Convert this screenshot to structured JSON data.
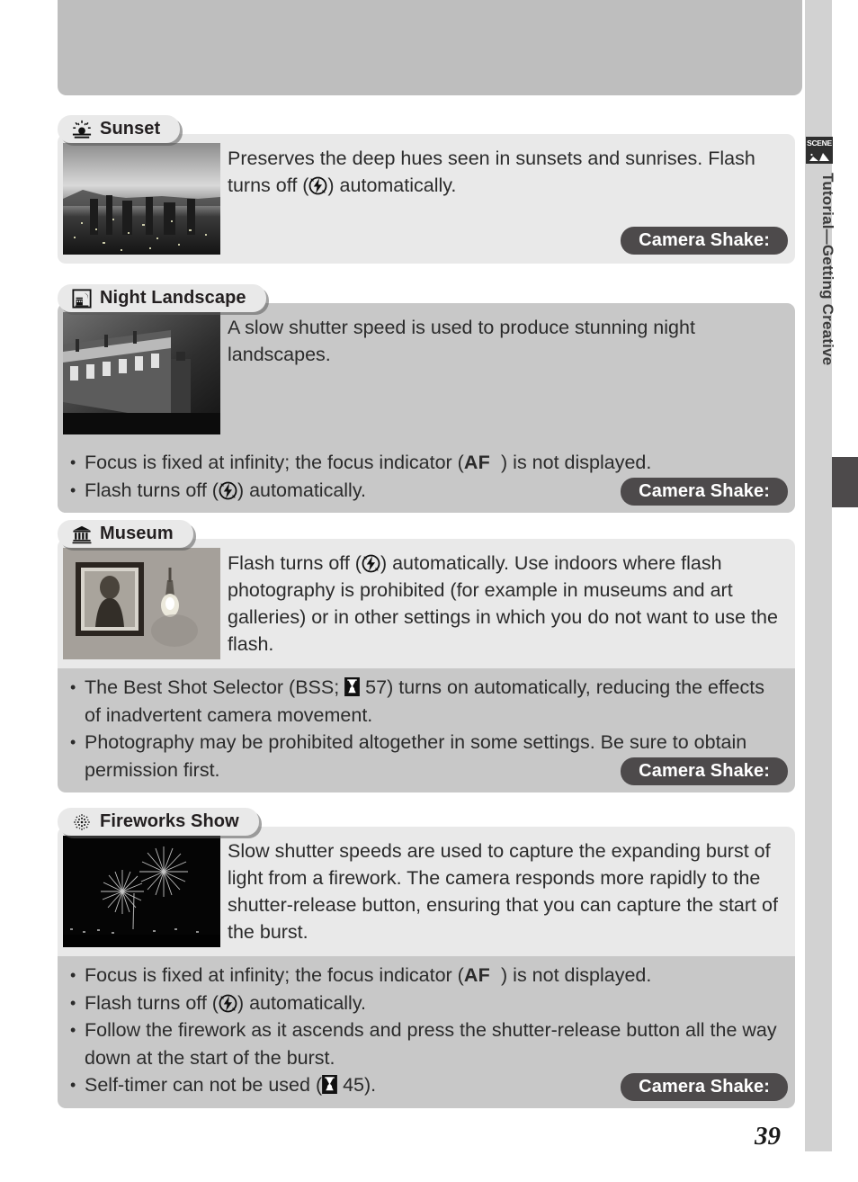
{
  "page": {
    "number": "39",
    "side_tab_label": "Tutorial—Getting Creative",
    "side_tab_icon": "scene-mode-icon",
    "scene_icon_word": "SCENE"
  },
  "colors": {
    "page_bg": "#ffffff",
    "top_block": "#bebebe",
    "panel_light": "#e9e9e9",
    "panel_mid": "#c8c8c8",
    "badge_dark": "#4d4a4b",
    "side_bar": "#d2d2d2",
    "text": "#2b2b2b",
    "heading": "#231f20"
  },
  "shake_badge_label": "Camera Shake:",
  "sections": [
    {
      "id": "sunset",
      "icon": "sunset-icon",
      "title": "Sunset",
      "thumb_alt": "city-skyline-at-sunset-photo",
      "description_parts": [
        {
          "t": "text",
          "v": "Preserves the deep hues seen in sunsets and sunrises.  Flash turns off ("
        },
        {
          "t": "icon",
          "v": "flash-off-icon"
        },
        {
          "t": "text",
          "v": ") automatically."
        }
      ],
      "description_plain": "Preserves the deep hues seen in sunsets and sunrises.  Flash turns off (flash-off-icon) automatically.",
      "bullets": []
    },
    {
      "id": "night-landscape",
      "icon": "night-landscape-icon",
      "title": "Night Landscape",
      "thumb_alt": "illuminated-building-at-night-photo",
      "description_parts": [
        {
          "t": "text",
          "v": "A slow shutter speed is used to produce stunning night landscapes."
        }
      ],
      "description_plain": "A slow shutter speed is used to produce stunning night landscapes.",
      "bullets": [
        [
          {
            "t": "text",
            "v": "Focus is fixed at infinity; the focus indicator ("
          },
          {
            "t": "af",
            "v": "AF"
          },
          {
            "t": "text",
            "v": "  ) is not displayed."
          }
        ],
        [
          {
            "t": "text",
            "v": "Flash turns off ("
          },
          {
            "t": "icon",
            "v": "flash-off-icon"
          },
          {
            "t": "text",
            "v": ") automatically."
          }
        ]
      ]
    },
    {
      "id": "museum",
      "icon": "museum-icon",
      "title": "Museum",
      "thumb_alt": "framed-painting-and-wall-lamp-photo",
      "description_parts": [
        {
          "t": "text",
          "v": "Flash turns off ("
        },
        {
          "t": "icon",
          "v": "flash-off-icon"
        },
        {
          "t": "text",
          "v": ") automatically.  Use indoors where flash photography is prohibited (for example in museums and art galleries) or in other settings in which you do not want to use the flash."
        }
      ],
      "description_plain": "Flash turns off (flash-off-icon) automatically.  Use indoors where flash photography is prohibited (for example in museums and art galleries) or in other settings in which you do not want to use the flash.",
      "bullets": [
        [
          {
            "t": "text",
            "v": "The Best Shot Selector (BSS; "
          },
          {
            "t": "pageref",
            "v": "page-reference-icon"
          },
          {
            "t": "text",
            "v": " 57) turns on automatically, reducing the effects of inadvertent camera movement."
          }
        ],
        [
          {
            "t": "text",
            "v": "Photography may be prohibited altogether in some settings.  Be sure to obtain permission first."
          }
        ]
      ]
    },
    {
      "id": "fireworks-show",
      "icon": "fireworks-icon",
      "title": "Fireworks Show",
      "thumb_alt": "fireworks-bursting-over-water-photo",
      "description_parts": [
        {
          "t": "text",
          "v": "Slow shutter speeds are used to capture the expanding burst of light from a firework.  The camera responds more rapidly to the shutter-release button, ensuring that you can capture the start of the burst."
        }
      ],
      "description_plain": "Slow shutter speeds are used to capture the expanding burst of light from a firework.  The camera responds more rapidly to the shutter-release button, ensuring that you can capture the start of the burst.",
      "bullets": [
        [
          {
            "t": "text",
            "v": "Focus is fixed at infinity; the focus indicator ("
          },
          {
            "t": "af",
            "v": "AF"
          },
          {
            "t": "text",
            "v": "  ) is not displayed."
          }
        ],
        [
          {
            "t": "text",
            "v": "Flash turns off ("
          },
          {
            "t": "icon",
            "v": "flash-off-icon"
          },
          {
            "t": "text",
            "v": ") automatically."
          }
        ],
        [
          {
            "t": "text",
            "v": "Follow the firework as it ascends and press the shutter-release button all the way down at the start of the burst."
          }
        ],
        [
          {
            "t": "text",
            "v": "Self-timer can not be used ("
          },
          {
            "t": "pageref",
            "v": "page-reference-icon"
          },
          {
            "t": "text",
            "v": " 45)."
          }
        ]
      ]
    }
  ]
}
